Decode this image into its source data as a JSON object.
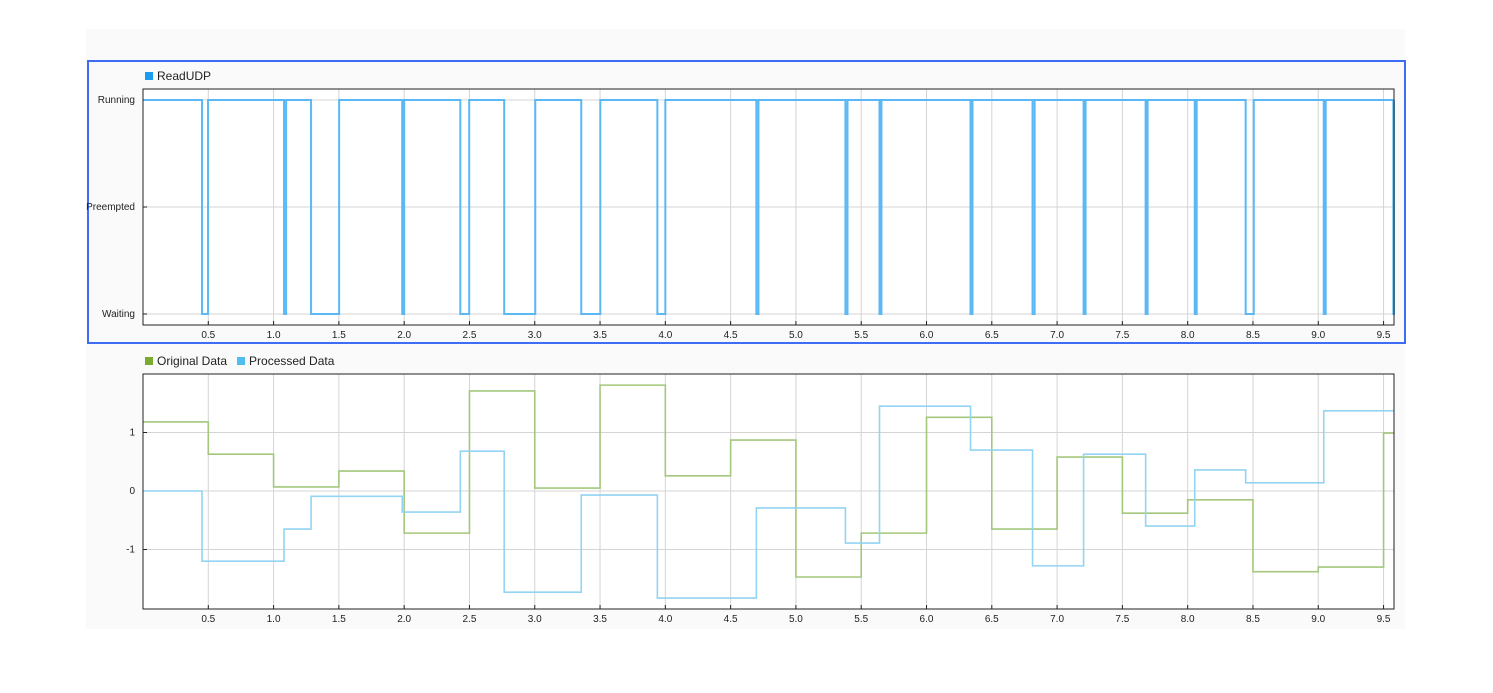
{
  "chart_data": [
    {
      "type": "line",
      "step": true,
      "legend": [
        {
          "name": "ReadUDP",
          "color": "#1a9cf0"
        }
      ],
      "legend_placement": "top-left",
      "line_color": "#5ab8f5",
      "yticks": [
        "Waiting",
        "Preempted",
        "Running"
      ],
      "xlim": [
        0,
        9.58
      ],
      "xticks": [
        "0.5",
        "1.0",
        "1.5",
        "2.0",
        "2.5",
        "3.0",
        "3.5",
        "4.0",
        "4.5",
        "5.0",
        "5.5",
        "6.0",
        "6.5",
        "7.0",
        "7.5",
        "8.0",
        "8.5",
        "9.0",
        "9.5"
      ],
      "grid": true,
      "waiting_intervals": [
        [
          0.452,
          0.498
        ],
        [
          1.08,
          1.096
        ],
        [
          1.287,
          1.502
        ],
        [
          1.985,
          2.0
        ],
        [
          2.43,
          2.498
        ],
        [
          2.766,
          3.004
        ],
        [
          3.356,
          3.502
        ],
        [
          3.939,
          4.0
        ],
        [
          4.697,
          4.713
        ],
        [
          5.379,
          5.395
        ],
        [
          5.64,
          5.655
        ],
        [
          6.337,
          6.352
        ],
        [
          6.812,
          6.828
        ],
        [
          7.203,
          7.218
        ],
        [
          7.678,
          7.693
        ],
        [
          8.054,
          8.069
        ],
        [
          8.444,
          8.506
        ],
        [
          9.042,
          9.057
        ],
        [
          9.575,
          9.58
        ]
      ]
    },
    {
      "type": "line",
      "step": true,
      "legend_placement": "top-left",
      "xlim": [
        0,
        9.58
      ],
      "ylim": [
        -2,
        2
      ],
      "yticks": [
        "-1",
        "0",
        "1"
      ],
      "xticks": [
        "0.5",
        "1.0",
        "1.5",
        "2.0",
        "2.5",
        "3.0",
        "3.5",
        "4.0",
        "4.5",
        "5.0",
        "5.5",
        "6.0",
        "6.5",
        "7.0",
        "7.5",
        "8.0",
        "8.5",
        "9.0",
        "9.5"
      ],
      "grid": true,
      "series": [
        {
          "name": "Original Data",
          "color": "#77ac30",
          "line_color": "#a3c77c",
          "x": [
            0,
            0.5,
            1.0,
            1.5,
            2.0,
            2.5,
            3.0,
            3.5,
            4.0,
            4.5,
            5.0,
            5.5,
            6.0,
            6.5,
            7.0,
            7.5,
            8.0,
            8.5,
            9.0,
            9.5
          ],
          "y": [
            1.18,
            0.63,
            0.07,
            0.34,
            -0.72,
            1.71,
            0.05,
            1.81,
            0.26,
            0.87,
            -1.47,
            -0.72,
            1.26,
            -0.65,
            0.58,
            -0.38,
            -0.15,
            -1.38,
            -1.3,
            0.99
          ]
        },
        {
          "name": "Processed Data",
          "color": "#4dbeee",
          "line_color": "#92d4f3",
          "x": [
            0,
            0.452,
            1.08,
            1.287,
            1.985,
            2.43,
            2.766,
            3.356,
            3.939,
            4.697,
            5.379,
            5.64,
            6.337,
            6.812,
            7.203,
            7.678,
            8.054,
            8.444,
            9.042
          ],
          "y": [
            0,
            -1.2,
            -0.65,
            -0.09,
            -0.36,
            0.68,
            -1.73,
            -0.07,
            -1.83,
            -0.29,
            -0.89,
            1.45,
            0.7,
            -1.28,
            0.63,
            -0.6,
            0.36,
            0.14,
            1.37
          ]
        }
      ]
    }
  ]
}
